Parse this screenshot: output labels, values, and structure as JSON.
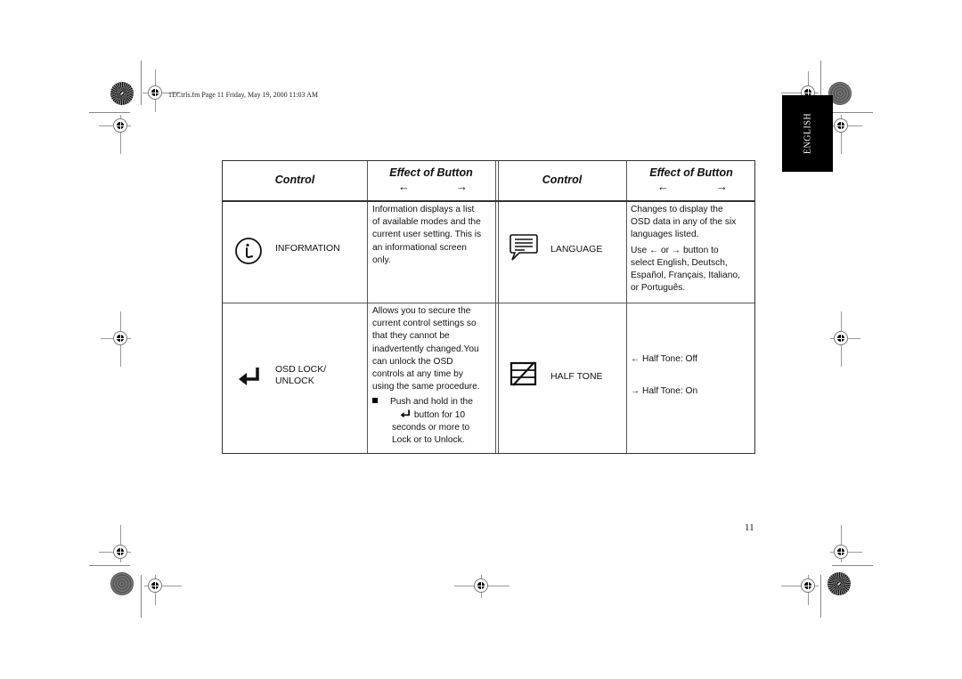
{
  "header": {
    "file_meta": "1ECtrls.fm  Page 11  Friday, May 19, 2000  11:03 AM",
    "language_tab": "ENGLISH"
  },
  "page_number": "11",
  "table": {
    "columns": [
      {
        "label": "Control"
      },
      {
        "label": "Effect of Button",
        "left_arrow": "←",
        "right_arrow": "→"
      },
      {
        "label": "Control"
      },
      {
        "label": "Effect of Button",
        "left_arrow": "←",
        "right_arrow": "→"
      }
    ],
    "rows": [
      {
        "left": {
          "icon": "information-icon",
          "label": "INFORMATION",
          "description": [
            "Information displays a list",
            "of available modes and the",
            "current user setting. This is",
            "an informational screen",
            "only."
          ]
        },
        "right": {
          "icon": "language-speech-bubble-icon",
          "label": "LANGUAGE",
          "description": [
            "Changes to display the",
            "OSD data in any of the six",
            "languages listed."
          ],
          "description2_prefix": "Use",
          "description2_mid": "or",
          "description2_suffix": "button to",
          "description2_rest": [
            "select English, Deutsch,",
            "Español, Français, Italiano,",
            "or Português."
          ]
        }
      },
      {
        "left": {
          "icon": "enter-key-icon",
          "label_line1": "OSD LOCK/",
          "label_line2": "UNLOCK",
          "description": [
            "Allows you to secure the",
            "current control settings so",
            "that they cannot be",
            "inadvertently changed.You",
            "can unlock the OSD",
            "controls at any time by",
            "using the same procedure."
          ],
          "bullet_line1": "Push and hold in the",
          "bullet_line2": "button for 10",
          "bullet_rest": [
            "seconds or more to",
            "Lock or to Unlock."
          ]
        },
        "right": {
          "icon": "half-tone-icon",
          "label": "HALF TONE",
          "options": [
            {
              "arrow": "←",
              "text": "Half Tone: Off"
            },
            {
              "arrow": "→",
              "text": "Half Tone: On"
            }
          ]
        }
      }
    ]
  }
}
